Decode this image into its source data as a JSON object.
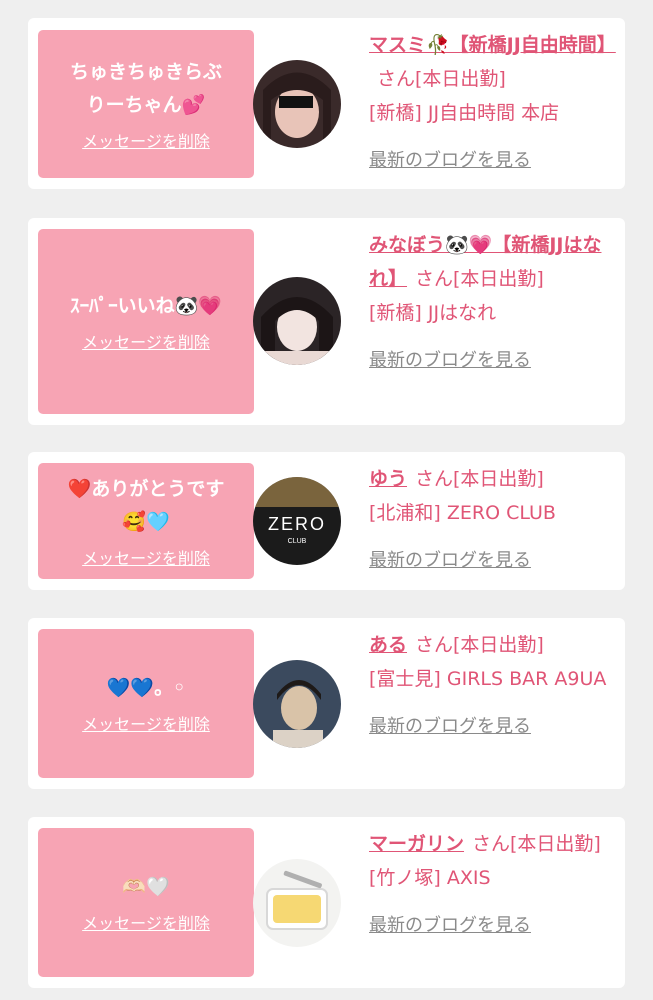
{
  "cards": [
    {
      "message": "ちゅきちゅきらぶ\nりーちゃん💕",
      "delete_label": "メッセージを削除",
      "name": "マスミ🥀【新橋JJ自由時間】",
      "suffix": "さん[本日出勤]",
      "shop": "[新橋] JJ自由時間 本店",
      "blog_label": "最新のブログを見る",
      "avatar_colors": [
        "#3a2a2a",
        "#e8c4b8"
      ]
    },
    {
      "message": "ｽｰﾊﾟｰいいね🐼💗",
      "delete_label": "メッセージを削除",
      "name": "みなぼう🐼💗【新橋JJはなれ】",
      "suffix": "さん[本日出勤]",
      "shop": "[新橋] JJはなれ",
      "blog_label": "最新のブログを見る",
      "avatar_colors": [
        "#2b2426",
        "#f2e4e0"
      ]
    },
    {
      "message": "❤️ありがとうです\n🥰🩵",
      "delete_label": "メッセージを削除",
      "name": "ゆう",
      "suffix": "さん[本日出勤]",
      "shop": "[北浦和] ZERO CLUB",
      "blog_label": "最新のブログを見る",
      "avatar_colors": [
        "#1b1b1b",
        "#c8a15a"
      ],
      "avatar_text": "ZERO",
      "avatar_subtext": "CLUB"
    },
    {
      "message": "💙💙。◦",
      "delete_label": "メッセージを削除",
      "name": "ある",
      "suffix": "さん[本日出勤]",
      "shop": "[富士見] GIRLS BAR A9UA",
      "blog_label": "最新のブログを見る",
      "avatar_colors": [
        "#3b4a5e",
        "#d9c3a8"
      ]
    },
    {
      "message": "🫶🏻🤍",
      "delete_label": "メッセージを削除",
      "name": "マーガリン",
      "suffix": "さん[本日出勤]",
      "shop": "[竹ノ塚] AXIS",
      "blog_label": "最新のブログを見る",
      "avatar_colors": [
        "#f3f3f1",
        "#f6d873"
      ]
    }
  ]
}
